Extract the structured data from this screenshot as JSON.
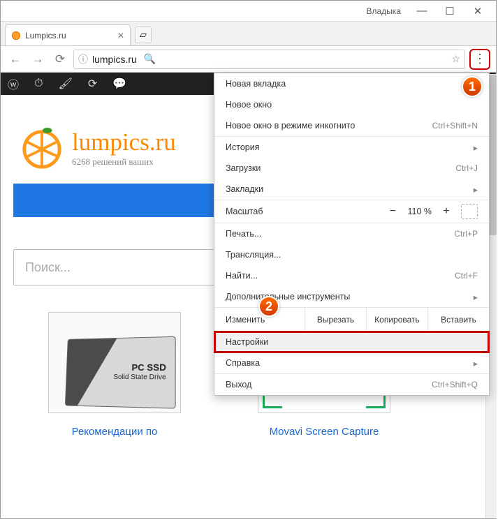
{
  "titlebar": {
    "user": "Владыка"
  },
  "tab": {
    "title": "Lumpics.ru"
  },
  "url": {
    "text": "lumpics.ru"
  },
  "wp_icons": [
    "wordpress",
    "gauge",
    "brush",
    "refresh",
    "comment"
  ],
  "brand": {
    "title": "lumpics.ru",
    "sub": "6268 решений ваших"
  },
  "search": {
    "placeholder": "Поиск..."
  },
  "cards": {
    "ssd": {
      "label_small": "Solid State Drive",
      "label_big": "PC SSD",
      "link": "Рекомендации по"
    },
    "movavi": {
      "link": "Movavi Screen Capture"
    }
  },
  "menu": {
    "new_tab": "Новая вкладка",
    "new_window": "Новое окно",
    "new_incognito": "Новое окно в режиме инкогнито",
    "new_incognito_sc": "Ctrl+Shift+N",
    "history": "История",
    "downloads": "Загрузки",
    "downloads_sc": "Ctrl+J",
    "bookmarks": "Закладки",
    "zoom_label": "Масштаб",
    "zoom_value": "110 %",
    "print": "Печать...",
    "print_sc": "Ctrl+P",
    "cast": "Трансляция...",
    "find": "Найти...",
    "find_sc": "Ctrl+F",
    "more_tools": "Дополнительные инструменты",
    "edit_label": "Изменить",
    "cut": "Вырезать",
    "copy": "Копировать",
    "paste": "Вставить",
    "settings": "Настройки",
    "help": "Справка",
    "exit": "Выход",
    "exit_sc": "Ctrl+Shift+Q"
  },
  "markers": {
    "one": "1",
    "two": "2"
  }
}
